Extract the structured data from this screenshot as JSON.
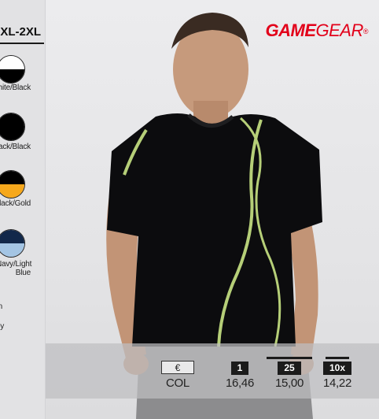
{
  "sidebar": {
    "size_range": "XL-2XL",
    "colours": [
      {
        "label": "White/Black",
        "top": "#ffffff",
        "bottom": "#000000"
      },
      {
        "label": "Black/Black",
        "top": "#000000",
        "bottom": "#000000"
      },
      {
        "label": "Black/Gold",
        "top": "#000000",
        "bottom": "#f6a81c"
      },
      {
        "label": "Navy/Light Blue",
        "top": "#12284a",
        "bottom": "#a4c5e4"
      }
    ],
    "partial_labels": [
      "n",
      "y"
    ]
  },
  "brand": {
    "part1": "GAME",
    "part2": "GEAR",
    "mark": "®",
    "color": "#e2001a"
  },
  "prices": {
    "currency_symbol": "€",
    "code": "COL",
    "tiers": [
      {
        "qty": "1",
        "price": "16,46"
      },
      {
        "qty": "25",
        "price": "15,00"
      },
      {
        "qty": "10x",
        "price": "14,22"
      }
    ]
  }
}
